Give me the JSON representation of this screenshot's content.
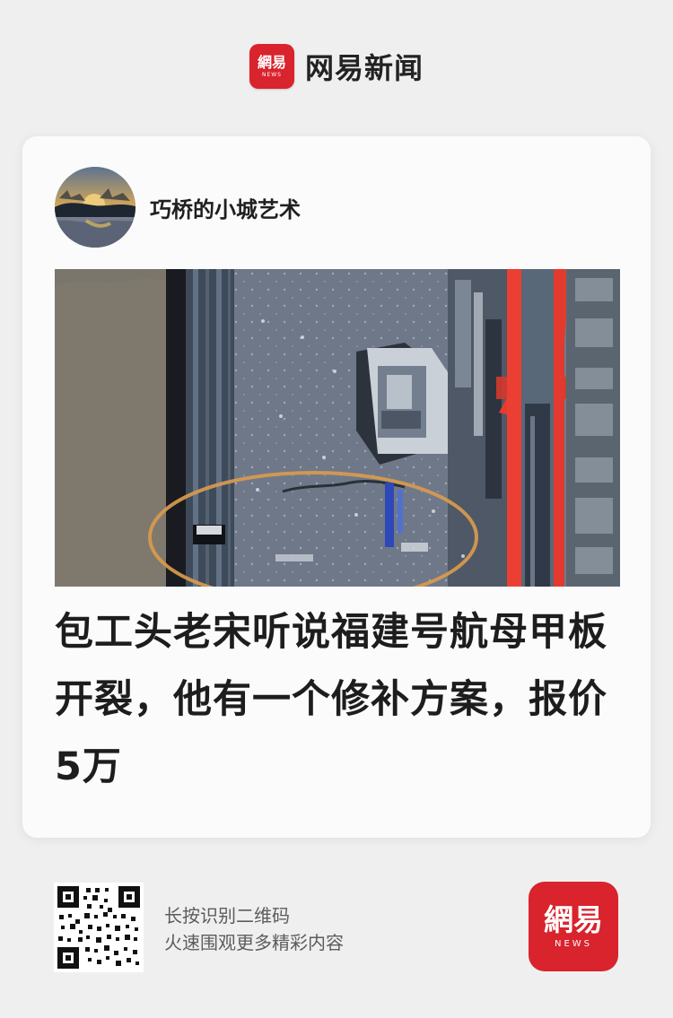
{
  "brand": {
    "logo_glyphs": "網易",
    "logo_sub": "NEWS",
    "name": "网易新闻",
    "color": "#d9232d"
  },
  "author": {
    "name": "巧桥的小城艺术"
  },
  "article": {
    "headline": "包工头老宋听说福建号航母甲板开裂，他有一个修补方案，报价5万"
  },
  "footer": {
    "line1": "长按识别二维码",
    "line2": "火速围观更多精彩内容"
  },
  "icons": {
    "avatar": "sunset-avatar",
    "qr": "qr-code-icon"
  }
}
